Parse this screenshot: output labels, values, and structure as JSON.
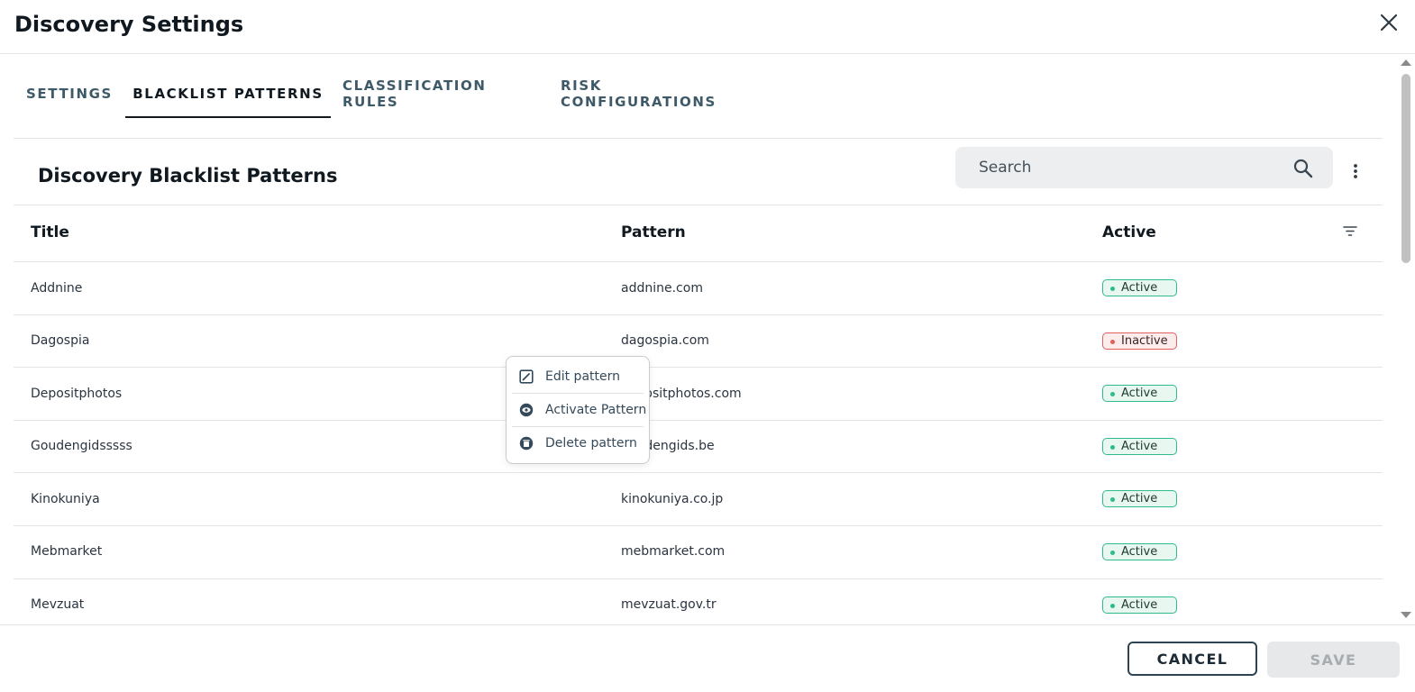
{
  "dialog": {
    "title": "Discovery Settings",
    "close_icon": "close-icon"
  },
  "tabs": [
    {
      "label": "SETTINGS",
      "active": false
    },
    {
      "label": "BLACKLIST PATTERNS",
      "active": true
    },
    {
      "label": "CLASSIFICATION RULES",
      "active": false
    },
    {
      "label": "RISK CONFIGURATIONS",
      "active": false
    }
  ],
  "section": {
    "title": "Discovery Blacklist Patterns",
    "search_placeholder": "Search",
    "search_icon": "search-icon",
    "more_icon": "more-vertical-icon"
  },
  "table": {
    "columns": [
      "Title",
      "Pattern",
      "Active"
    ],
    "filter_icon": "filter-icon",
    "rows": [
      {
        "title": "Addnine",
        "pattern": "addnine.com",
        "status": "Active"
      },
      {
        "title": "Dagospia",
        "pattern": "dagospia.com",
        "status": "Inactive"
      },
      {
        "title": "Depositphotos",
        "pattern": "depositphotos.com",
        "status": "Active"
      },
      {
        "title": "Goudengidsssss",
        "pattern": "goudengids.be",
        "status": "Active"
      },
      {
        "title": "Kinokuniya",
        "pattern": "kinokuniya.co.jp",
        "status": "Active"
      },
      {
        "title": "Mebmarket",
        "pattern": "mebmarket.com",
        "status": "Active"
      },
      {
        "title": "Mevzuat",
        "pattern": "mevzuat.gov.tr",
        "status": "Active"
      }
    ]
  },
  "context_menu": {
    "items": [
      {
        "label": "Edit pattern",
        "icon": "edit-icon"
      },
      {
        "label": "Activate Pattern",
        "icon": "eye-icon"
      },
      {
        "label": "Delete pattern",
        "icon": "trash-icon"
      }
    ]
  },
  "footer": {
    "cancel_label": "CANCEL",
    "save_label": "SAVE"
  },
  "colors": {
    "active_badge": "#2fba8e",
    "inactive_badge": "#e0605e",
    "tab_active": "#101820",
    "tab_inactive": "#3e5a68"
  }
}
